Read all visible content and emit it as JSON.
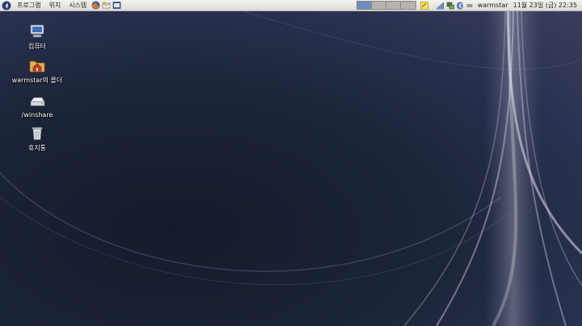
{
  "panel": {
    "menus": [
      "프로그램",
      "위치",
      "시스템"
    ],
    "launchers": [
      "firefox-icon",
      "email-client-icon",
      "text-editor-icon"
    ],
    "workspaces": [
      true,
      false,
      false,
      false,
      false
    ],
    "tray_icons": [
      "notes-icon",
      "signal-strength-icon",
      "network-icon",
      "bluetooth-icon",
      "volume-icon"
    ],
    "user": "warmstar",
    "clock": "11월 23일 (금) 22:35"
  },
  "desktop_icons": [
    {
      "label": "컴퓨터",
      "icon": "computer-icon"
    },
    {
      "label": "warmstar의 폴더",
      "icon": "home-folder-icon"
    },
    {
      "label": "/winshare",
      "icon": "drive-icon"
    },
    {
      "label": "휴지통",
      "icon": "trash-icon"
    }
  ]
}
